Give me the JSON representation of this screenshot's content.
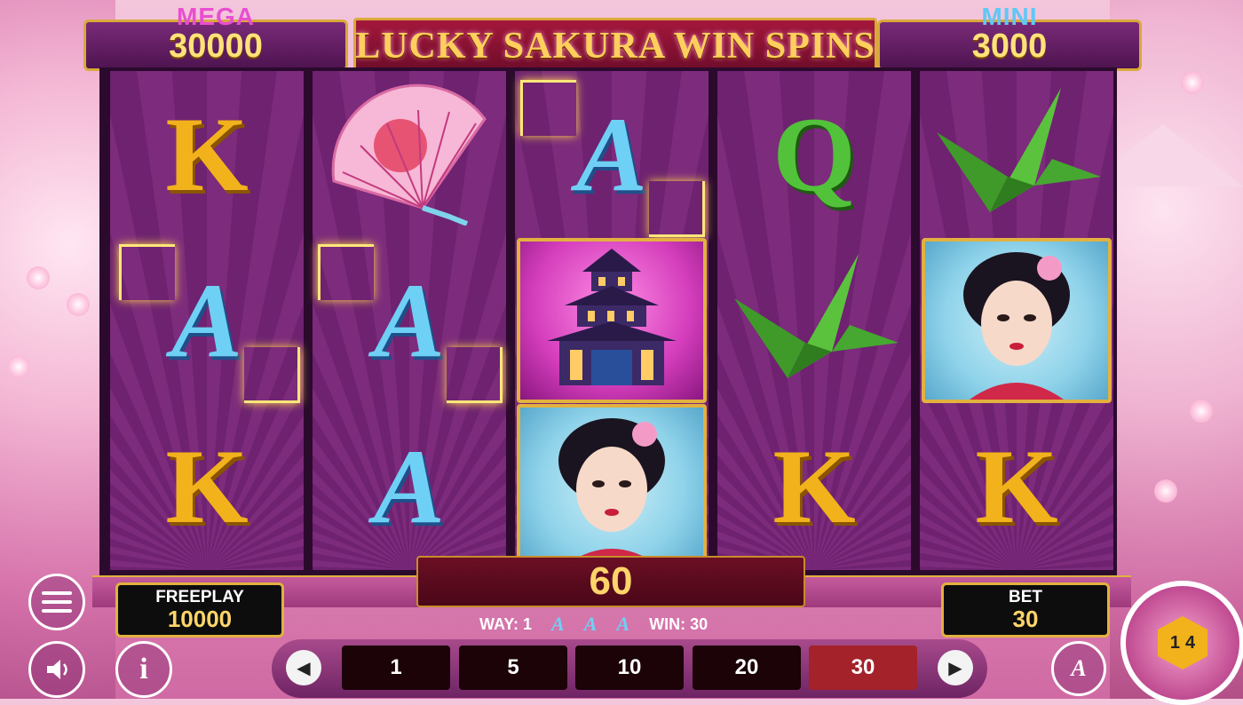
{
  "jackpots": {
    "mega": {
      "label": "MEGA",
      "value": "30000",
      "label_color": "#e94fd0"
    },
    "mini": {
      "label": "MINI",
      "value": "3000",
      "label_color": "#5fc8f5"
    }
  },
  "title": "LUCKY SAKURA WIN SPINS",
  "reels": [
    [
      {
        "symbol": "K",
        "kind": "letter-k"
      },
      {
        "symbol": "A",
        "kind": "letter-a",
        "winning": true
      },
      {
        "symbol": "K",
        "kind": "letter-k"
      }
    ],
    [
      {
        "symbol": "fan-icon",
        "kind": "fan"
      },
      {
        "symbol": "A",
        "kind": "letter-a",
        "winning": true
      },
      {
        "symbol": "A",
        "kind": "letter-a"
      }
    ],
    [
      {
        "symbol": "A",
        "kind": "letter-a",
        "winning": true
      },
      {
        "symbol": "pagoda-icon",
        "kind": "pagoda"
      },
      {
        "symbol": "geisha-icon",
        "kind": "geisha"
      }
    ],
    [
      {
        "symbol": "Q",
        "kind": "letter-q"
      },
      {
        "symbol": "crane-icon",
        "kind": "crane"
      },
      {
        "symbol": "K",
        "kind": "letter-k"
      }
    ],
    [
      {
        "symbol": "crane-icon",
        "kind": "crane"
      },
      {
        "symbol": "geisha-icon",
        "kind": "geisha"
      },
      {
        "symbol": "K",
        "kind": "letter-k"
      }
    ]
  ],
  "win_amount": "60",
  "freeplay": {
    "label": "FREEPLAY",
    "value": "10000"
  },
  "bet": {
    "label": "BET",
    "value": "30"
  },
  "way_line": {
    "way_text": "WAY: 1",
    "win_text": "WIN: 30"
  },
  "bet_options": [
    "1",
    "5",
    "10",
    "20",
    "30"
  ],
  "selected_bet": "30",
  "spin_counter": {
    "top": "1",
    "right": "4"
  },
  "autoplay_label": "A",
  "colors": {
    "accent_gold": "#e2b13f",
    "active_bet": "#a4222a"
  }
}
